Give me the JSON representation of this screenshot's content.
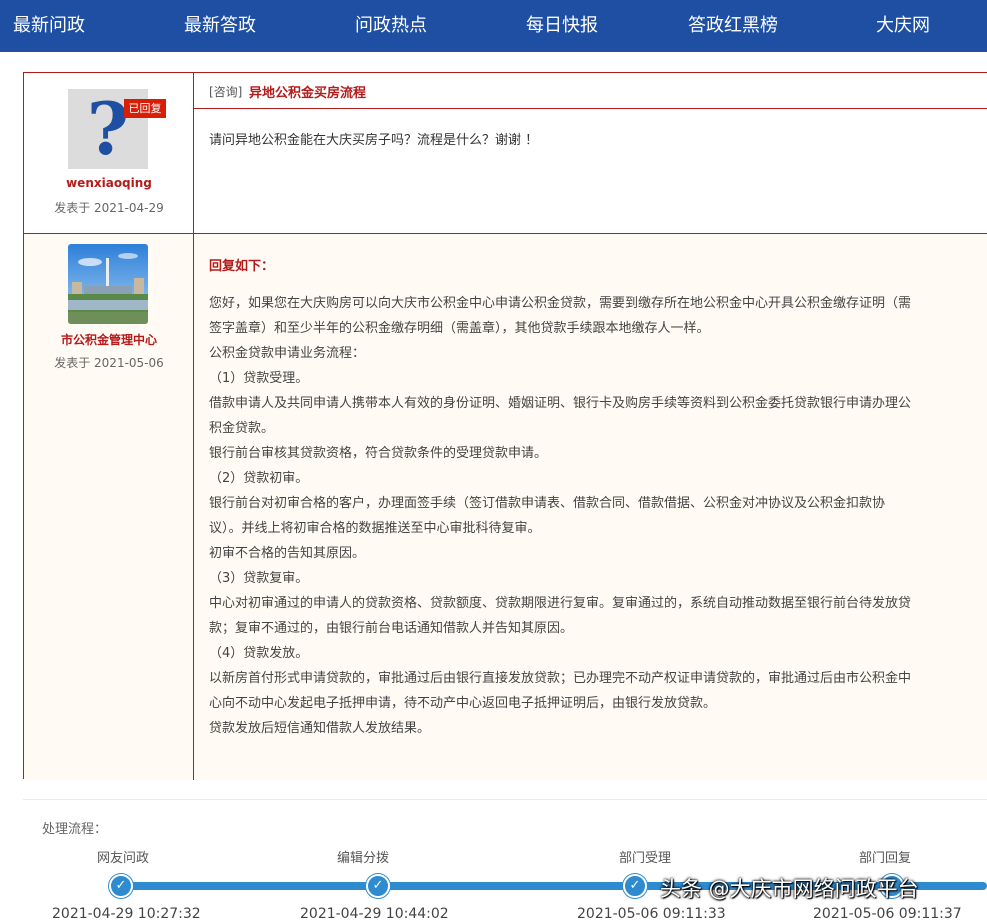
{
  "nav": {
    "items": [
      "最新问政",
      "最新答政",
      "问政热点",
      "每日快报",
      "答政红黑榜",
      "大庆网"
    ]
  },
  "question": {
    "tag": "[咨询]",
    "title": "异地公积金买房流程",
    "body": "请问异地公积金能在大庆买房子吗？流程是什么？谢谢 ！",
    "author": "wenxiaoqing",
    "date": "发表于 2021-04-29",
    "badge": "已回复",
    "avatar_icon": "question-mark-icon"
  },
  "reply": {
    "heading": "回复如下：",
    "org": "市公积金管理中心",
    "date": "发表于 2021-05-06",
    "lines": [
      "您好，如果您在大庆购房可以向大庆市公积金中心申请公积金贷款，需要到缴存所在地公积金中心开具公积金缴存证明（需",
      "签字盖章）和至少半年的公积金缴存明细（需盖章），其他贷款手续跟本地缴存人一样。",
      "公积金贷款申请业务流程：",
      "（1）贷款受理。",
      "借款申请人及共同申请人携带本人有效的身份证明、婚姻证明、银行卡及购房手续等资料到公积金委托贷款银行申请办理公",
      "积金贷款。",
      "银行前台审核其贷款资格，符合贷款条件的受理贷款申请。",
      "（2）贷款初审。",
      "银行前台对初审合格的客户，办理面签手续（签订借款申请表、借款合同、借款借据、公积金对冲协议及公积金扣款协",
      "议）。并线上将初审合格的数据推送至中心审批科待复审。",
      "初审不合格的告知其原因。",
      "（3）贷款复审。",
      "中心对初审通过的申请人的贷款资格、贷款额度、贷款期限进行复审。复审通过的，系统自动推动数据至银行前台待发放贷",
      "款；复审不通过的，由银行前台电话通知借款人并告知其原因。",
      "（4）贷款发放。",
      "以新房首付形式申请贷款的，审批通过后由银行直接发放贷款；已办理完不动产权证申请贷款的，审批通过后由市公积金中",
      "心向不动中心发起电子抵押申请，待不动产中心返回电子抵押证明后，由银行发放贷款。",
      "贷款发放后短信通知借款人发放结果。"
    ]
  },
  "process": {
    "label": "处理流程：",
    "steps": [
      {
        "name": "网友问政",
        "time": "2021-04-29 10:27:32"
      },
      {
        "name": "编辑分拨",
        "time": "2021-04-29 10:44:02"
      },
      {
        "name": "部门受理",
        "time": "2021-05-06 09:11:33"
      },
      {
        "name": "部门回复",
        "time": "2021-05-06 09:11:37"
      }
    ]
  },
  "watermark": "头条 @大庆市网络问政平台",
  "colors": {
    "nav_bg": "#1e4fa3",
    "accent_red": "#b41b1b",
    "badge_red": "#d81e06",
    "track_blue": "#2e8bcf",
    "reply_bg": "#fffaf3"
  }
}
